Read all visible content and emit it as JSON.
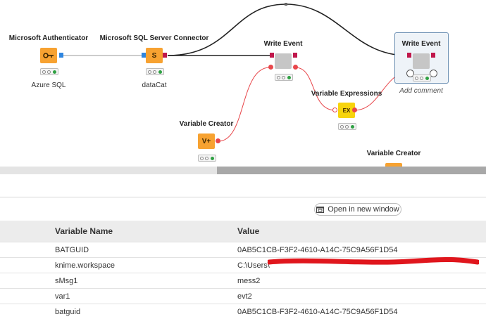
{
  "workflow": {
    "nodes": [
      {
        "id": "ms-auth",
        "title": "Microsoft Authenticator",
        "caption": "Azure SQL",
        "icon": "key-icon"
      },
      {
        "id": "sql-conn",
        "title": "Microsoft SQL Server Connector",
        "caption": "dataCat",
        "icon": "database-icon",
        "glyph": "S"
      },
      {
        "id": "write-event-1",
        "title": "Write Event",
        "caption": ""
      },
      {
        "id": "var-creator-1",
        "title": "Variable Creator",
        "caption": "",
        "glyph": "V+"
      },
      {
        "id": "var-expr",
        "title": "Variable Expressions",
        "caption": "",
        "glyph": "EX"
      },
      {
        "id": "write-event-2",
        "title": "Write Event",
        "caption": "Add comment"
      },
      {
        "id": "var-creator-2",
        "title": "Variable Creator",
        "caption": ""
      }
    ],
    "colors": {
      "data_port": "#c0174b",
      "conn_port": "#2f86e0",
      "flow_wire": "#e8474b",
      "orange_node": "#f7a231",
      "yellow_node": "#f7d40c",
      "success": "#2ea043"
    }
  },
  "toolbar": {
    "open_in_window_label": "Open in new window"
  },
  "variables_table": {
    "headers": [
      "Variable Name",
      "Value"
    ],
    "rows": [
      {
        "name": "BATGUID",
        "value": "0AB5C1CB-F3F2-4610-A14C-75C9A56F1D54"
      },
      {
        "name": "knime.workspace",
        "value": "C:\\Users\\"
      },
      {
        "name": "sMsg1",
        "value": "mess2"
      },
      {
        "name": "var1",
        "value": "evt2"
      },
      {
        "name": "batguid",
        "value": "0AB5C1CB-F3F2-4610-A14C-75C9A56F1D54"
      }
    ]
  }
}
